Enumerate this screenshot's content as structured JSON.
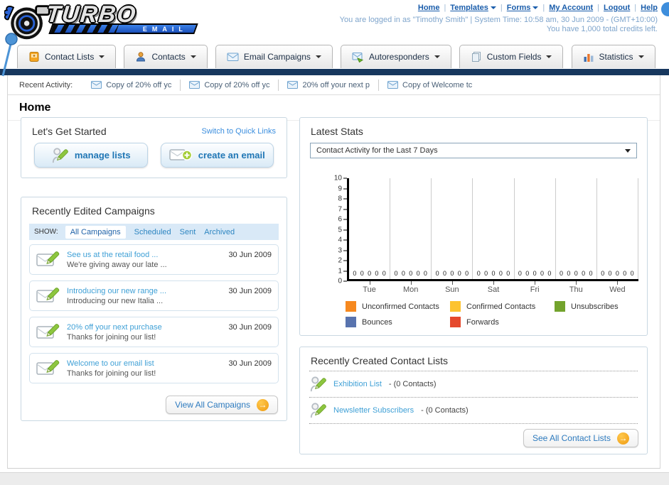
{
  "page": {
    "title": "Home"
  },
  "header": {
    "logo": {
      "title": "TURBO",
      "subtitle": "EMAIL"
    },
    "separator": "|",
    "nav": [
      {
        "label": "Home",
        "dropdown": false
      },
      {
        "label": "Templates",
        "dropdown": true
      },
      {
        "label": "Forms",
        "dropdown": true
      },
      {
        "label": "My Account",
        "dropdown": false
      },
      {
        "label": "Logout",
        "dropdown": false
      },
      {
        "label": "Help",
        "dropdown": false
      }
    ],
    "login_info": "You are logged in as \"Timothy Smith\" | System Time: 10:58 am, 30 Jun 2009 - (GMT+10:00)",
    "credits_info": "You have 1,000 total credits left."
  },
  "tabs": [
    {
      "label": "Contact Lists"
    },
    {
      "label": "Contacts"
    },
    {
      "label": "Email Campaigns"
    },
    {
      "label": "Autoresponders"
    },
    {
      "label": "Custom Fields"
    },
    {
      "label": "Statistics"
    }
  ],
  "recent_activity": {
    "label": "Recent Activity:",
    "items": [
      "Copy of 20% off yc",
      "Copy of 20% off yc",
      "20% off your next p",
      "Copy of Welcome tc"
    ]
  },
  "get_started": {
    "title": "Let's Get Started",
    "switch_link": "Switch to Quick Links",
    "manage_lists_label": "manage lists",
    "create_email_label": "create an email"
  },
  "campaigns": {
    "title": "Recently Edited Campaigns",
    "show_label": "SHOW:",
    "filters": [
      "All Campaigns",
      "Scheduled",
      "Sent",
      "Archived"
    ],
    "active_filter": "All Campaigns",
    "items": [
      {
        "title": "See us at the retail food ...",
        "subtitle": "We're giving away our late ...",
        "date": "30 Jun 2009"
      },
      {
        "title": "Introducing our new range ...",
        "subtitle": "Introducing our new Italia ...",
        "date": "30 Jun 2009"
      },
      {
        "title": "20% off your next purchase",
        "subtitle": "Thanks for joining our list!",
        "date": "30 Jun 2009"
      },
      {
        "title": "Welcome to our email list",
        "subtitle": "Thanks for joining our list!",
        "date": "30 Jun 2009"
      }
    ],
    "view_all_label": "View All Campaigns"
  },
  "stats": {
    "title": "Latest Stats",
    "dropdown_value": "Contact Activity for the Last 7 Days"
  },
  "chart_data": {
    "type": "bar",
    "title": "Contact Activity for the Last 7 Days",
    "categories": [
      "Tue",
      "Mon",
      "Sun",
      "Sat",
      "Fri",
      "Thu",
      "Wed"
    ],
    "series": [
      {
        "name": "Unconfirmed Contacts",
        "color": "#F6891F",
        "values": [
          0,
          0,
          0,
          0,
          0,
          0,
          0
        ]
      },
      {
        "name": "Confirmed Contacts",
        "color": "#FDC32F",
        "values": [
          0,
          0,
          0,
          0,
          0,
          0,
          0
        ]
      },
      {
        "name": "Unsubscribes",
        "color": "#73A32D",
        "values": [
          0,
          0,
          0,
          0,
          0,
          0,
          0
        ]
      },
      {
        "name": "Bounces",
        "color": "#5873AE",
        "values": [
          0,
          0,
          0,
          0,
          0,
          0,
          0
        ]
      },
      {
        "name": "Forwards",
        "color": "#E5492D",
        "values": [
          0,
          0,
          0,
          0,
          0,
          0,
          0
        ]
      }
    ],
    "xlabel": "",
    "ylabel": "",
    "ylim": [
      0,
      10
    ],
    "yticks": [
      0,
      1,
      2,
      3,
      4,
      5,
      6,
      7,
      8,
      9,
      10
    ],
    "grid": "vertical",
    "legend_position": "bottom"
  },
  "contact_lists": {
    "title": "Recently Created Contact Lists",
    "items": [
      {
        "name": "Exhibition List",
        "detail": "- (0 Contacts)"
      },
      {
        "name": "Newsletter Subscribers",
        "detail": "- (0 Contacts)"
      }
    ],
    "see_all_label": "See All Contact Lists"
  }
}
